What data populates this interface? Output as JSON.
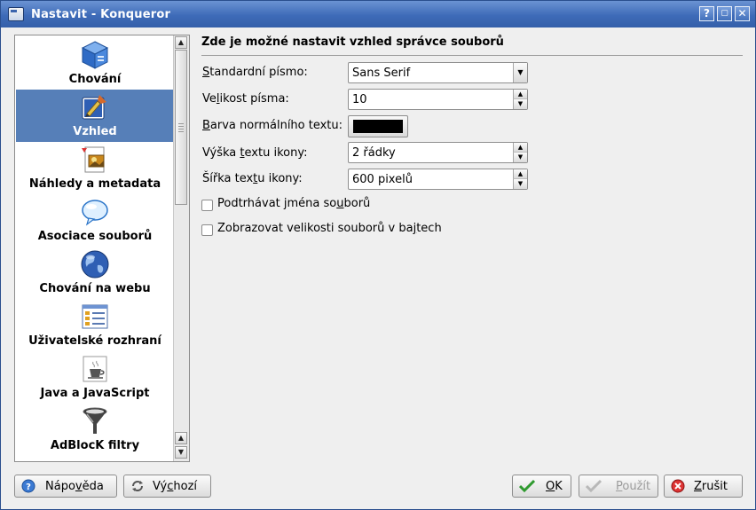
{
  "window": {
    "title": "Nastavit - Konqueror",
    "buttons": {
      "help": "?",
      "minimize": "▢",
      "close": "✕"
    }
  },
  "sidebar": {
    "items": [
      {
        "label": "Chování",
        "icon": "cube-icon"
      },
      {
        "label": "Vzhled",
        "icon": "paint-icon",
        "selected": true
      },
      {
        "label": "Náhledy a metadata",
        "icon": "preview-icon"
      },
      {
        "label": "Asociace souborů",
        "icon": "speech-bubble-icon"
      },
      {
        "label": "Chování na webu",
        "icon": "globe-icon"
      },
      {
        "label": "Uživatelské rozhraní",
        "icon": "interface-icon"
      },
      {
        "label": "Java a JavaScript",
        "icon": "java-cup-icon"
      },
      {
        "label": "AdBlocK filtry",
        "icon": "funnel-icon"
      }
    ]
  },
  "panel": {
    "heading": "Zde je možné nastavit vzhled správce souborů",
    "standard_font": {
      "label_pre": "",
      "label_u": "S",
      "label_post": "tandardní písmo:",
      "value": "Sans Serif"
    },
    "font_size": {
      "label_pre": "Ve",
      "label_u": "l",
      "label_post": "ikost písma:",
      "value": "10"
    },
    "text_color": {
      "label_pre": "",
      "label_u": "B",
      "label_post": "arva normálního textu:",
      "color": "#000000"
    },
    "icon_text_height": {
      "label_pre": "Výška ",
      "label_u": "t",
      "label_post": "extu ikony:",
      "value": "2 řádky"
    },
    "icon_text_width": {
      "label_pre": "Šířka tex",
      "label_u": "t",
      "label_post": "u ikony:",
      "value": "600 pixelů"
    },
    "underline_names": {
      "label_pre": "Podtrhávat jména so",
      "label_u": "u",
      "label_post": "borů",
      "checked": false
    },
    "show_bytes": {
      "label_pre": "Zobrazovat velikosti souborů v ba",
      "label_u": "j",
      "label_post": "tech",
      "checked": false
    }
  },
  "footer": {
    "help": {
      "pre": "Nápo",
      "u": "v",
      "post": "ěda"
    },
    "defaults": {
      "pre": "Vý",
      "u": "c",
      "post": "hozí"
    },
    "ok": {
      "pre": "",
      "u": "O",
      "post": "K"
    },
    "apply": {
      "pre": "",
      "u": "P",
      "post": "oužít",
      "disabled": true
    },
    "cancel": {
      "pre": "",
      "u": "Z",
      "post": "rušit"
    }
  },
  "colors": {
    "titlebar": "#3e6bb8",
    "selection": "#567fb8",
    "ok_check": "#2f9a2f",
    "cancel_red": "#d33"
  }
}
